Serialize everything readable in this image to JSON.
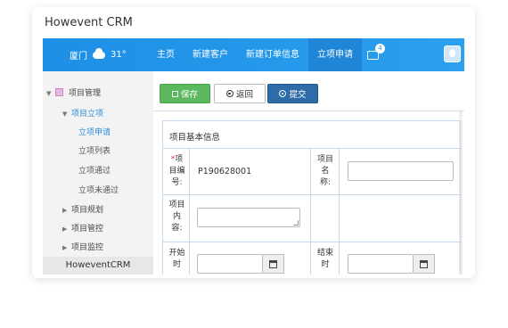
{
  "card": {
    "title": "Howevent CRM"
  },
  "topbar": {
    "city": "厦门",
    "temp": "31°",
    "nav": [
      "主页",
      "新建客户",
      "新建订单信息",
      "立项申请"
    ],
    "badge": "4"
  },
  "sidebar": {
    "root": "项目管理",
    "group": "项目立项",
    "items": [
      "立项申请",
      "立项列表",
      "立项通过",
      "立项未通过"
    ],
    "others": [
      "项目规划",
      "项目管控",
      "项目监控"
    ],
    "footer": "HoweventCRM"
  },
  "toolbar": {
    "save": "保存",
    "back": "返回",
    "submit": "提交"
  },
  "form": {
    "title": "项目基本信息",
    "project_no_label": [
      "项",
      "目编",
      "号:"
    ],
    "project_no_req": "*",
    "project_no_value": "P190628001",
    "project_name_label": [
      "项目",
      "名",
      "称:"
    ],
    "project_content_label": [
      "项目",
      "内",
      "容:"
    ],
    "start_label": [
      "开始",
      "时"
    ],
    "end_label": [
      "结束",
      "时"
    ]
  },
  "colors": {
    "topbar": "#1e8fe6",
    "save": "#5cb85c",
    "submit": "#2d6ca8",
    "link": "#2a8bd6"
  }
}
